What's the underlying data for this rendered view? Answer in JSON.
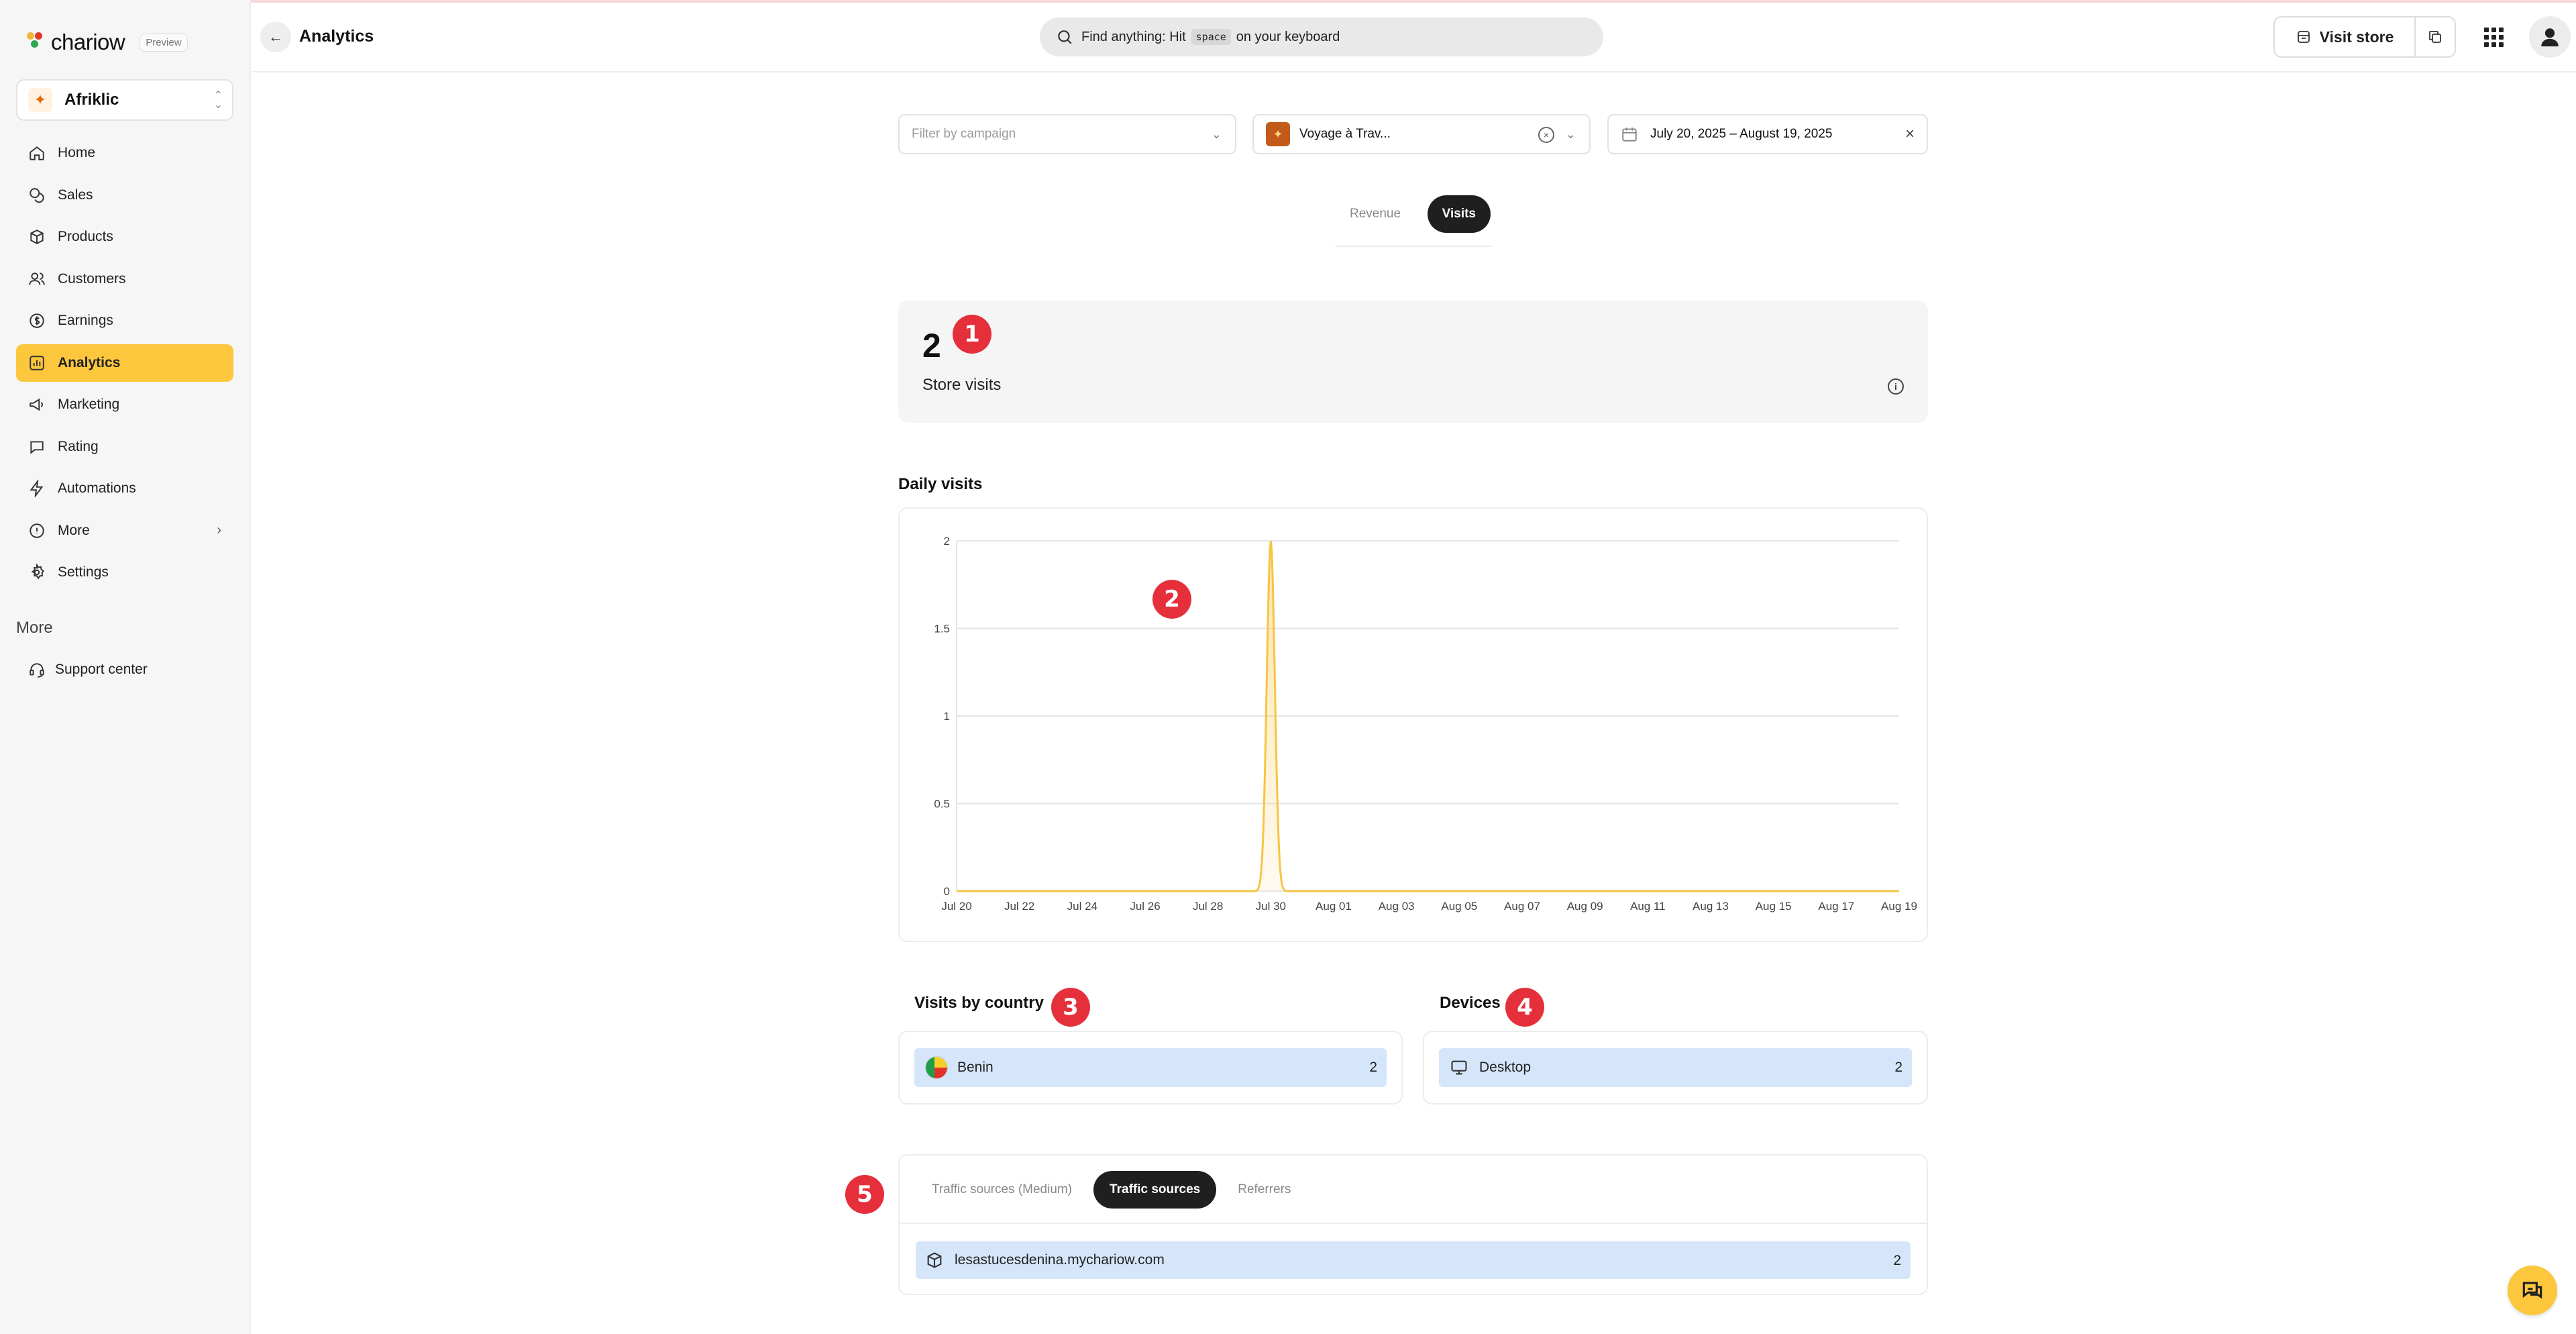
{
  "brand": {
    "logo_text": "chariow",
    "preview_badge": "Preview"
  },
  "store": {
    "name": "Afriklic"
  },
  "nav": {
    "items": [
      {
        "label": "Home",
        "icon": "home-icon"
      },
      {
        "label": "Sales",
        "icon": "coins-icon"
      },
      {
        "label": "Products",
        "icon": "box-icon"
      },
      {
        "label": "Customers",
        "icon": "users-icon"
      },
      {
        "label": "Earnings",
        "icon": "dollar-icon"
      },
      {
        "label": "Analytics",
        "icon": "chart-icon",
        "active": true
      },
      {
        "label": "Marketing",
        "icon": "megaphone-icon"
      },
      {
        "label": "Rating",
        "icon": "comment-icon"
      },
      {
        "label": "Automations",
        "icon": "bolt-icon"
      },
      {
        "label": "More",
        "icon": "info-icon",
        "has_submenu": true
      },
      {
        "label": "Settings",
        "icon": "gear-icon"
      }
    ],
    "more_heading": "More",
    "support_label": "Support center"
  },
  "header": {
    "title": "Analytics",
    "search_prefix": "Find anything: Hit",
    "search_key": "space",
    "search_suffix": "on your keyboard",
    "visit_store_label": "Visit store"
  },
  "filters": {
    "campaign_placeholder": "Filter by campaign",
    "product_value": "Voyage à Trav...",
    "date_range": "July 20, 2025 – August 19, 2025"
  },
  "metric_tabs": {
    "revenue": "Revenue",
    "visits": "Visits",
    "active": "Visits"
  },
  "store_visits": {
    "value": "2",
    "label": "Store visits"
  },
  "daily_visits": {
    "title": "Daily visits"
  },
  "chart_data": {
    "type": "area",
    "title": "Daily visits",
    "x": [
      "Jul 20",
      "Jul 21",
      "Jul 22",
      "Jul 23",
      "Jul 24",
      "Jul 25",
      "Jul 26",
      "Jul 27",
      "Jul 28",
      "Jul 29",
      "Jul 30",
      "Jul 31",
      "Aug 01",
      "Aug 02",
      "Aug 03",
      "Aug 04",
      "Aug 05",
      "Aug 06",
      "Aug 07",
      "Aug 08",
      "Aug 09",
      "Aug 10",
      "Aug 11",
      "Aug 12",
      "Aug 13",
      "Aug 14",
      "Aug 15",
      "Aug 16",
      "Aug 17",
      "Aug 18",
      "Aug 19"
    ],
    "tick_labels": [
      "Jul 20",
      "Jul 22",
      "Jul 24",
      "Jul 26",
      "Jul 28",
      "Jul 30",
      "Aug 01",
      "Aug 03",
      "Aug 05",
      "Aug 07",
      "Aug 09",
      "Aug 11",
      "Aug 13",
      "Aug 15",
      "Aug 17",
      "Aug 19"
    ],
    "series": [
      {
        "values": [
          0,
          0,
          0,
          0,
          0,
          0,
          0,
          0,
          0,
          0,
          2,
          0,
          0,
          0,
          0,
          0,
          0,
          0,
          0,
          0,
          0,
          0,
          0,
          0,
          0,
          0,
          0,
          0,
          0,
          0,
          0
        ]
      }
    ],
    "y_ticks": [
      "0",
      "0.5",
      "1",
      "1.5",
      "2"
    ],
    "ylim": [
      0,
      2
    ],
    "grid": true,
    "color": "#f7c544"
  },
  "visits_by_country": {
    "title": "Visits by country",
    "rows": [
      {
        "label": "Benin",
        "value": "2"
      }
    ]
  },
  "devices": {
    "title": "Devices",
    "rows": [
      {
        "label": "Desktop",
        "value": "2"
      }
    ]
  },
  "traffic": {
    "tabs": [
      "Traffic sources (Medium)",
      "Traffic sources",
      "Referrers"
    ],
    "active": "Traffic sources",
    "rows": [
      {
        "label": "lesastucesdenina.mychariow.com",
        "value": "2"
      }
    ]
  },
  "markers": [
    "1",
    "2",
    "3",
    "4",
    "5"
  ],
  "colors": {
    "accent": "#fcc73d",
    "marker": "#e5303c",
    "bar_fill": "#d5e6fa"
  }
}
